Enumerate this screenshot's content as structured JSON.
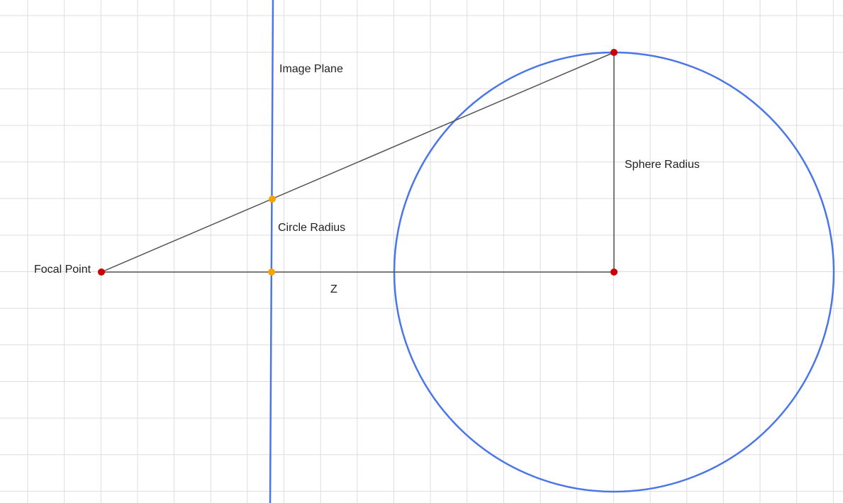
{
  "labels": {
    "image_plane": "Image Plane",
    "sphere_radius": "Sphere Radius",
    "circle_radius": "Circle Radius",
    "focal_point": "Focal Point",
    "z": "Z"
  },
  "colors": {
    "grid": "#dddddd",
    "construction_line": "#555555",
    "image_plane_line": "#4a76e8",
    "sphere_outline": "#4a76e8",
    "point_primary": "#cc0000",
    "point_intersection": "#f5a300"
  }
}
